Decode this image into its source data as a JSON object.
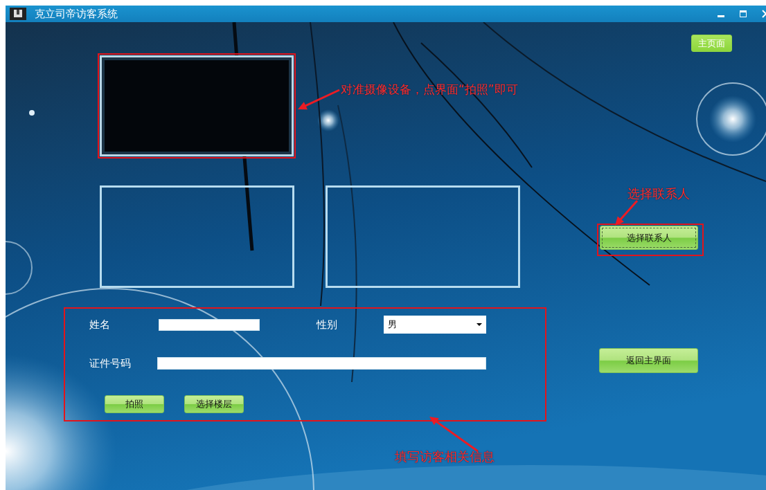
{
  "window": {
    "title": "克立司帝访客系统"
  },
  "home_button": {
    "label": "主页面"
  },
  "contact_button": {
    "label": "选择联系人",
    "focused": true
  },
  "back_button": {
    "label": "返回主界面"
  },
  "form": {
    "name_label": "姓名",
    "gender_label": "性别",
    "gender_value": "男",
    "id_label": "证件号码",
    "buttons": [
      "拍照",
      "选择楼层"
    ]
  },
  "annotations": [
    {
      "text": "对准摄像设备，点界面“拍照”即可"
    },
    {
      "text": "选择联系人"
    },
    {
      "text": "填写访客相关信息"
    }
  ]
}
